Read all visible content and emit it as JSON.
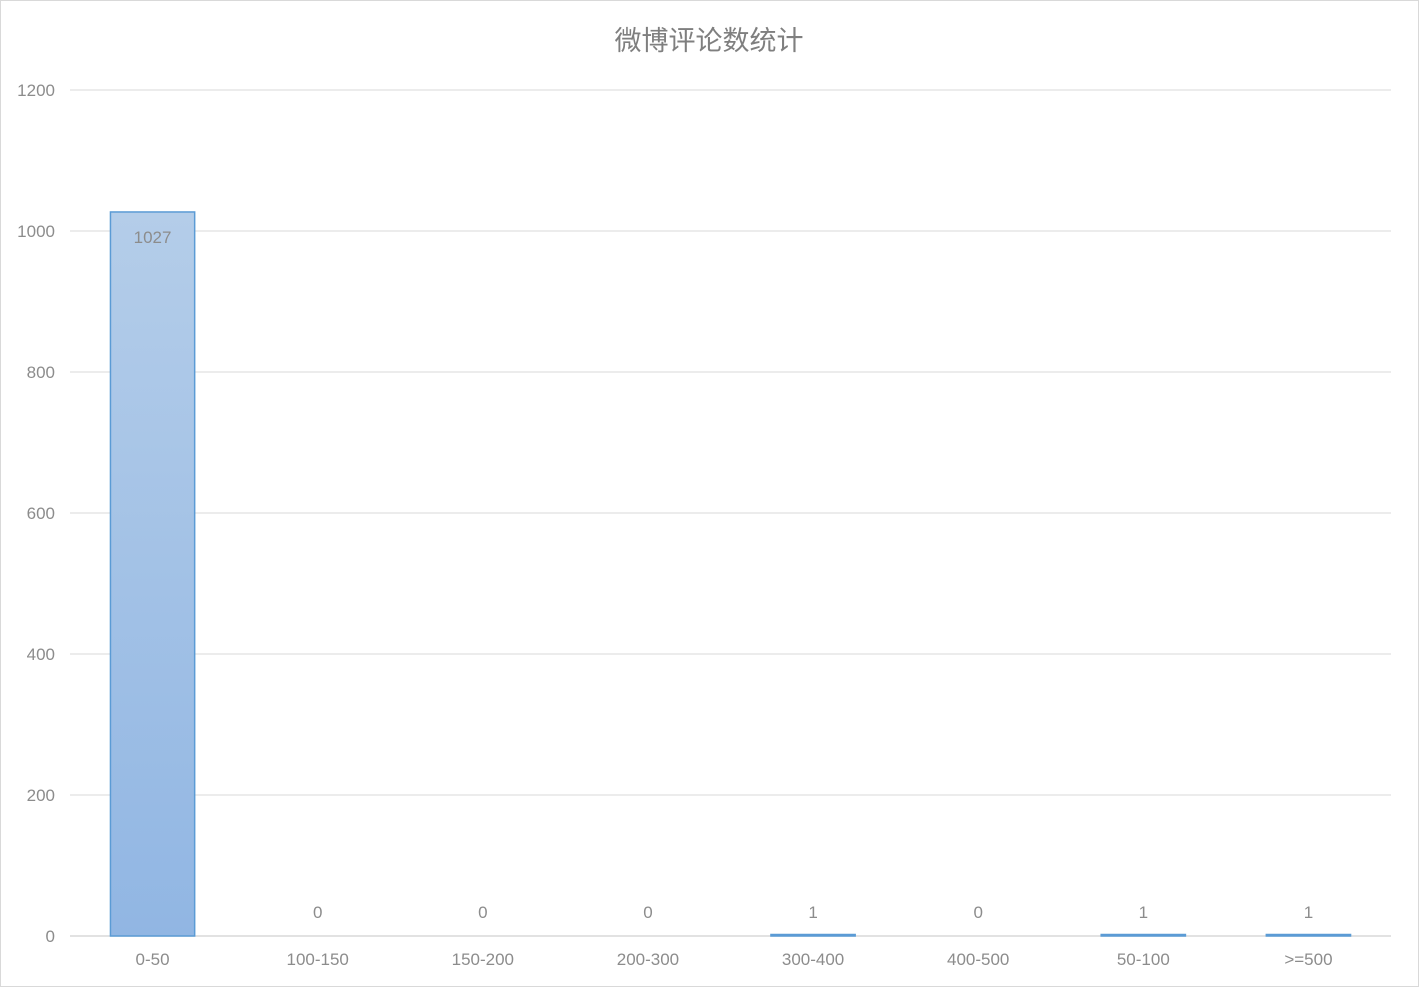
{
  "chart_data": {
    "type": "bar",
    "title": "微博评论数统计",
    "xlabel": "",
    "ylabel": "",
    "categories": [
      "0-50",
      "100-150",
      "150-200",
      "200-300",
      "300-400",
      "400-500",
      "50-100",
      ">=500"
    ],
    "values": [
      1027,
      0,
      0,
      0,
      1,
      0,
      1,
      1
    ],
    "data_labels": [
      "1027",
      "0",
      "0",
      "0",
      "1",
      "0",
      "1",
      "1"
    ],
    "ylim": [
      0,
      1200
    ],
    "yticks": [
      0,
      200,
      400,
      600,
      800,
      1000,
      1200
    ],
    "ytick_labels": [
      "0",
      "200",
      "400",
      "600",
      "800",
      "1000",
      "1200"
    ],
    "grid": true,
    "legend": "none",
    "colors": {
      "bar_top": "#b4cde9",
      "bar_bottom": "#91b6e3",
      "bar_border": "#5b9bd5",
      "grid": "#d9d9d9",
      "text": "#8c8c8c",
      "title": "#7f7f7f"
    }
  }
}
